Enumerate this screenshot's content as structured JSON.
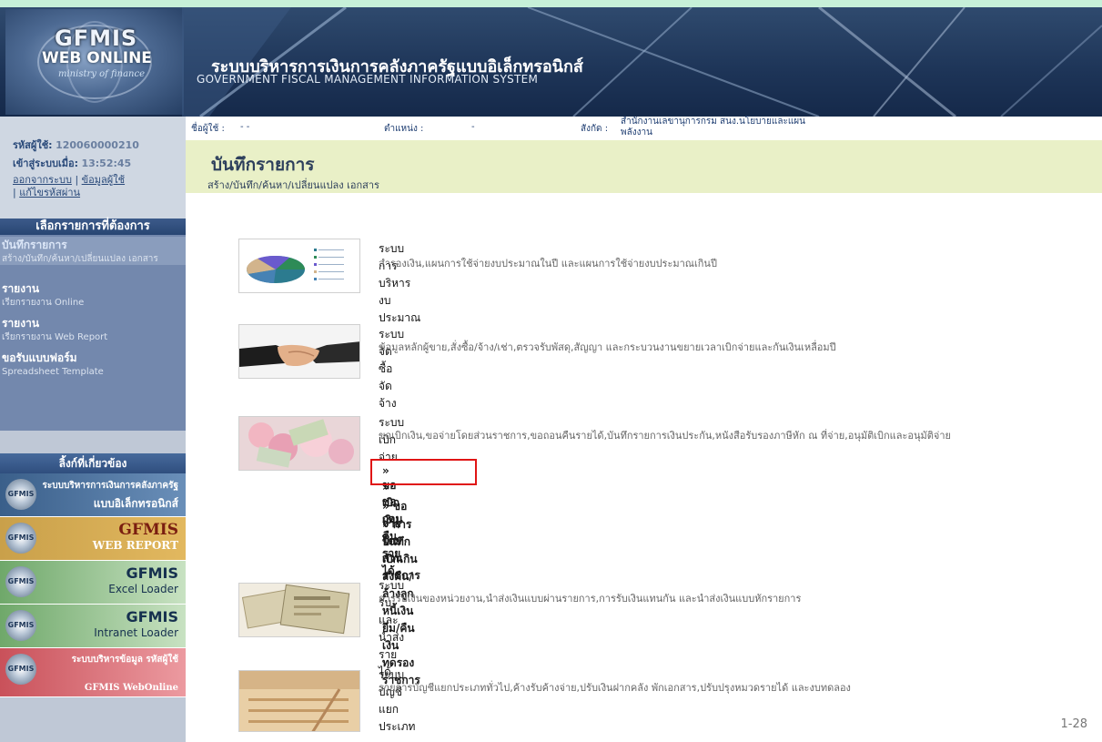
{
  "header": {
    "logo": {
      "line1": "GFMIS",
      "line2": "WEB ONLINE",
      "line3": "ministry of finance"
    },
    "title_th": "ระบบบริหารการเงินการคลังภาครัฐแบบอิเล็กทรอนิกส์",
    "title_en": "GOVERNMENT FISCAL MANAGEMENT INFORMATION SYSTEM"
  },
  "user": {
    "id_label": "รหัสผู้ใช้:",
    "id_value": "120060000210",
    "login_label": "เข้าสู่ระบบเมื่อ:",
    "login_time": "13:52:45",
    "logout": "ออกจากระบบ",
    "profile": "ข้อมูลผู้ใช้",
    "change_password": "แก้ไขรหัสผ่าน",
    "sep": "|"
  },
  "userbar": {
    "name_label": "ชื่อผู้ใช้ :",
    "name_value": "- -",
    "position_label": "ตำแหน่ง :",
    "position_value": "-",
    "dept_label": "สังกัด :",
    "dept_value": "สำนักงานเลขานุการกรม สนง.นโยบายและแผนพลังงาน"
  },
  "sidebar": {
    "menu_header": "เลือกรายการที่ต้องการ",
    "items": [
      {
        "title": "บันทึกรายการ",
        "sub": "สร้าง/บันทึก/ค้นหา/เปลี่ยนแปลง เอกสาร"
      },
      {
        "title": "รายงาน",
        "sub": "เรียกรายงาน Online"
      },
      {
        "title": "รายงาน",
        "sub": "เรียกรายงาน Web Report"
      },
      {
        "title": "ขอรับแบบฟอร์ม",
        "sub": "Spreadsheet Template"
      }
    ],
    "related_header": "ลิ้งก์ที่เกี่ยวข้อง",
    "banners": [
      {
        "icon": "GFMIS",
        "line1": "ระบบบริหารการเงินการคลังภาครัฐ",
        "line2": "แบบอิเล็กทรอนิกส์"
      },
      {
        "icon": "GFMIS",
        "line1": "GFMIS",
        "line2": "WEB REPORT"
      },
      {
        "icon": "GFMIS",
        "line1": "GFMIS",
        "line2": "Excel Loader"
      },
      {
        "icon": "GFMIS",
        "line1": "GFMIS",
        "line2": "Intranet Loader"
      },
      {
        "icon": "GFMIS",
        "line1": "ระบบบริหารข้อมูล รหัสผู้ใช้",
        "line2": "GFMIS WebOnline"
      }
    ]
  },
  "main": {
    "title": "บันทึกรายการ",
    "subtitle": "สร้าง/บันทึก/ค้นหา/เปลี่ยนแปลง เอกสาร",
    "modules": [
      {
        "title": "ระบบการบริหารงบประมาณ",
        "desc": "สำรองเงิน,แผนการใช้จ่ายงบประมาณในปี และแผนการใช้จ่ายงบประมาณเกินปี",
        "thumb": "pie-chart-image"
      },
      {
        "title": "ระบบจัดซื้อจัดจ้าง",
        "desc": "ข้อมูลหลักผู้ขาย,สั่งซื้อ/จ้าง/เช่า,ตรวจรับพัสดุ,สัญญา และกระบวนงานขยายเวลาเบิกจ่ายและกันเงินเหลื่อมปี",
        "thumb": "handshake-image"
      },
      {
        "title": "ระบบเบิกจ่าย",
        "desc": "ขอเบิกเงิน,ขอจ่ายโดยส่วนราชการ,ขอถอนคืนรายได้,บันทึกรายการเงินประกัน,หนังสือรับรองภาษีหัก ณ ที่จ่าย,อนุมัติเบิกและอนุมัติจ่าย",
        "thumb": "money-flowers-image",
        "links": [
          "» ขอเบิกเงิน",
          "» ขอถอนคืนรายได้",
          "» ขอจ่ายโดยส่วนราชการ",
          "» การบันทึกเบิกเกินส่งคืน/ล้างลูกหนี้เงินยืม/คืนเงินทดรองราชการ"
        ]
      },
      {
        "title": "ระบบรับและนำส่งรายได้",
        "desc": "การรับเงินของหน่วยงาน,นำส่งเงินแบบผ่านรายการ,การรับเงินแทนกัน และนำส่งเงินแบบหักรายการ",
        "thumb": "banknotes-image"
      },
      {
        "title": "ระบบบัญชีแยกประเภท",
        "desc": "รายการบัญชีแยกประเภททั่วไป,ค้างรับค้างจ่าย,ปรับเงินฝากคลัง พักเอกสาร,ปรับปรุงหมวดรายได้ และงบทดลอง",
        "thumb": "ledger-image"
      }
    ]
  },
  "page_number": "1-28",
  "colors": {
    "highlight": "#e01515",
    "header": "#1d3457",
    "titlebar": "#e9f0c7",
    "menu": "#7388ad"
  }
}
